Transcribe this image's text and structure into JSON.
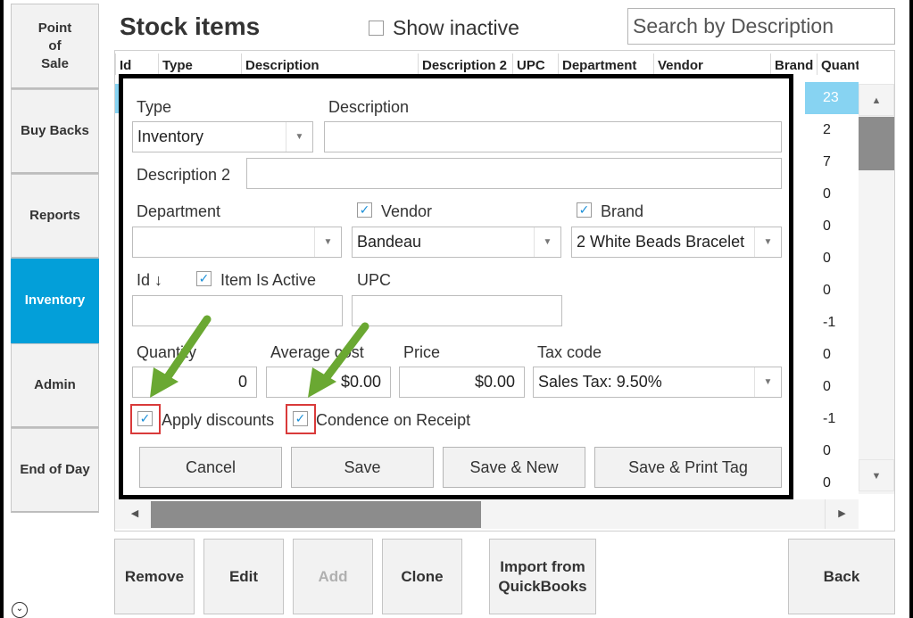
{
  "sidebar": {
    "items": [
      {
        "label": "Point\nof\nSale",
        "active": false
      },
      {
        "label": "Buy Backs",
        "active": false
      },
      {
        "label": "Reports",
        "active": false
      },
      {
        "label": "Inventory",
        "active": true
      },
      {
        "label": "Admin",
        "active": false
      },
      {
        "label": "End of Day",
        "active": false
      }
    ],
    "collapse_icon": "chevron-down-circle-icon"
  },
  "header": {
    "title": "Stock items",
    "show_inactive_label": "Show inactive",
    "show_inactive_checked": false,
    "search_placeholder": "Search by Description"
  },
  "grid": {
    "columns": [
      "Id",
      "Type",
      "Description",
      "Description 2",
      "UPC",
      "Department",
      "Vendor",
      "Brand",
      "Quant"
    ],
    "quantities": [
      "23",
      "2",
      "7",
      "0",
      "0",
      "0",
      "0",
      "-1",
      "0",
      "0",
      "-1",
      "0",
      "0"
    ],
    "selected_row": 0
  },
  "modal": {
    "type_label": "Type",
    "type_value": "Inventory",
    "description_label": "Description",
    "description_value": "",
    "description2_label": "Description 2",
    "description2_value": "",
    "department_label": "Department",
    "department_value": "",
    "vendor_label": "Vendor",
    "vendor_checked": true,
    "vendor_value": "Bandeau",
    "brand_label": "Brand",
    "brand_checked": true,
    "brand_value": "2 White Beads Bracelet",
    "id_label": "Id ↓",
    "item_active_label": "Item Is Active",
    "item_active_checked": true,
    "id_value": "",
    "upc_label": "UPC",
    "upc_value": "",
    "quantity_label": "Quantity",
    "quantity_value": "0",
    "avg_cost_label": "Average cost",
    "avg_cost_value": "$0.00",
    "price_label": "Price",
    "price_value": "$0.00",
    "tax_code_label": "Tax code",
    "tax_code_value": "Sales Tax: 9.50%",
    "apply_discounts_label": "Apply discounts",
    "apply_discounts_checked": true,
    "condense_label": "Condence on Receipt",
    "condense_checked": true,
    "buttons": {
      "cancel": "Cancel",
      "save": "Save",
      "save_new": "Save & New",
      "save_print": "Save & Print Tag"
    }
  },
  "bottom_buttons": {
    "remove": "Remove",
    "edit": "Edit",
    "add": "Add",
    "clone": "Clone",
    "import": "Import from\nQuickBooks",
    "back": "Back"
  },
  "colors": {
    "accent": "#039fd9",
    "selected_row": "#87d3f2",
    "highlight": "#d93a3a",
    "arrow": "#6aa832"
  }
}
